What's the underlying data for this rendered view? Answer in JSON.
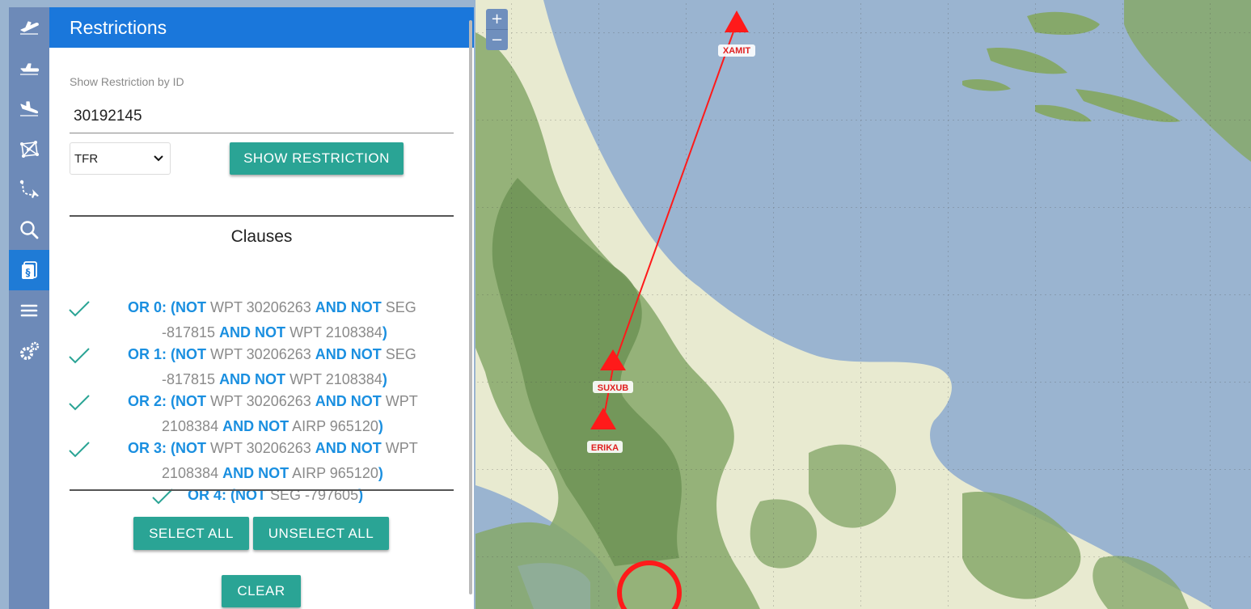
{
  "map": {
    "zoom_in_label": "+",
    "zoom_out_label": "−",
    "route_color": "#ff1a1a",
    "waypoints": [
      "XAMIT",
      "SUXUB",
      "ERIKA"
    ]
  },
  "sidebar": {
    "items": [
      {
        "icon": "plane-takeoff-icon"
      },
      {
        "icon": "plane-icon"
      },
      {
        "icon": "plane-landing-icon"
      },
      {
        "icon": "network-icon"
      },
      {
        "icon": "route-icon"
      },
      {
        "icon": "search-icon"
      },
      {
        "icon": "restriction-doc-icon",
        "active": true
      },
      {
        "icon": "menu-icon"
      },
      {
        "icon": "settings-icon"
      }
    ]
  },
  "panel": {
    "title": "Restrictions",
    "id_label": "Show Restriction by ID",
    "id_value": "30192145",
    "type_selected": "TFR",
    "show_button": "SHOW RESTRICTION",
    "clauses_title": "Clauses",
    "clauses": [
      {
        "checked": true,
        "line1": [
          [
            "kw",
            "OR 0: (NOT"
          ],
          [
            "tx",
            " WPT 30206263 "
          ],
          [
            "kw",
            "AND NOT"
          ],
          [
            "tx",
            " SEG"
          ]
        ],
        "line2": [
          [
            "tx",
            "-817815 "
          ],
          [
            "kw",
            "AND NOT"
          ],
          [
            "tx",
            " WPT 2108384"
          ],
          [
            "kw",
            ")"
          ]
        ]
      },
      {
        "checked": true,
        "line1": [
          [
            "kw",
            "OR 1: (NOT"
          ],
          [
            "tx",
            " WPT 30206263 "
          ],
          [
            "kw",
            "AND NOT"
          ],
          [
            "tx",
            " SEG"
          ]
        ],
        "line2": [
          [
            "tx",
            "-817815 "
          ],
          [
            "kw",
            "AND NOT"
          ],
          [
            "tx",
            " WPT 2108384"
          ],
          [
            "kw",
            ")"
          ]
        ]
      },
      {
        "checked": true,
        "line1": [
          [
            "kw",
            "OR 2: (NOT"
          ],
          [
            "tx",
            " WPT 30206263 "
          ],
          [
            "kw",
            "AND NOT"
          ],
          [
            "tx",
            " WPT"
          ]
        ],
        "line2": [
          [
            "tx",
            "2108384 "
          ],
          [
            "kw",
            "AND NOT"
          ],
          [
            "tx",
            " AIRP 965120"
          ],
          [
            "kw",
            ")"
          ]
        ]
      },
      {
        "checked": true,
        "line1": [
          [
            "kw",
            "OR 3: (NOT"
          ],
          [
            "tx",
            " WPT 30206263 "
          ],
          [
            "kw",
            "AND NOT"
          ],
          [
            "tx",
            " WPT"
          ]
        ],
        "line2": [
          [
            "tx",
            "2108384 "
          ],
          [
            "kw",
            "AND NOT"
          ],
          [
            "tx",
            " AIRP 965120"
          ],
          [
            "kw",
            ")"
          ]
        ]
      },
      {
        "checked": true,
        "line1": [
          [
            "kw",
            "OR 4: (NOT"
          ],
          [
            "tx",
            " SEG -797605"
          ],
          [
            "kw",
            ")"
          ]
        ]
      }
    ],
    "select_all": "SELECT ALL",
    "unselect_all": "UNSELECT ALL",
    "clear": "CLEAR"
  },
  "colors": {
    "header": "#1a77db",
    "teal_button": "#2aa495",
    "keyword_blue": "#1a8fe0",
    "rail": "#6d8ab8",
    "rail_active": "#1f7bd6"
  }
}
